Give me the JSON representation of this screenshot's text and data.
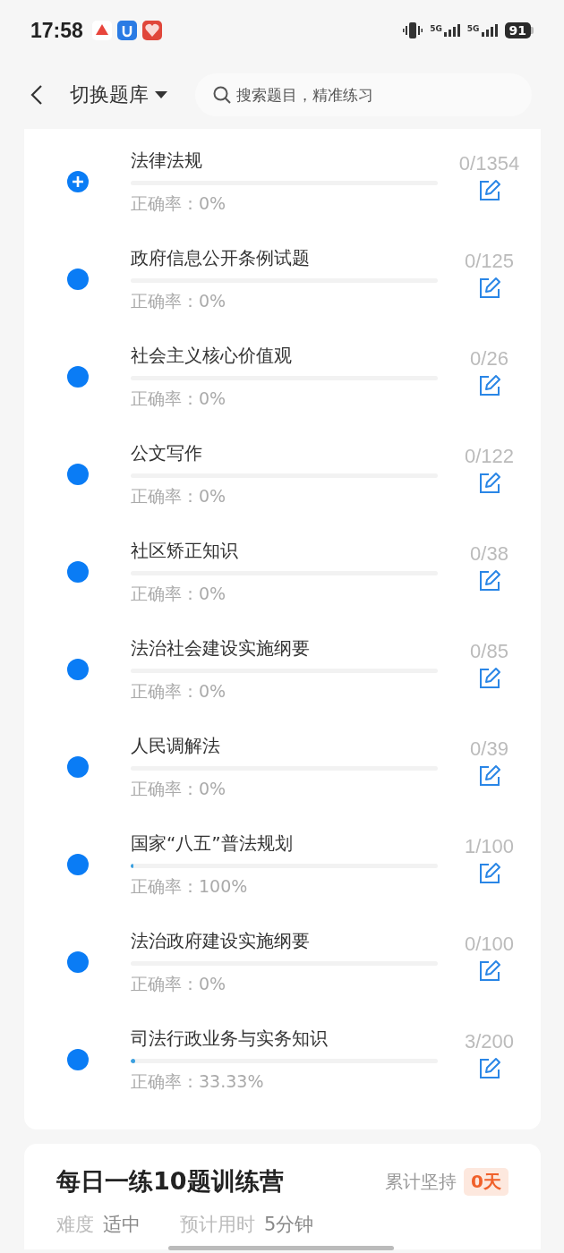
{
  "status_bar": {
    "time": "17:58",
    "network_1": "5G",
    "network_2": "5G",
    "battery": "91"
  },
  "nav": {
    "title": "切换题库",
    "search": {
      "placeholder": "搜索题目，精准练习"
    }
  },
  "categories": [
    {
      "name": "法律法规",
      "expandable": true,
      "level": 0,
      "accuracy": "正确率：0%",
      "count": "0/1354"
    },
    {
      "name": "政府信息公开条例试题",
      "expandable": false,
      "level": 0,
      "accuracy": "正确率：0%",
      "count": "0/125"
    },
    {
      "name": "社会主义核心价值观",
      "expandable": false,
      "level": 0,
      "accuracy": "正确率：0%",
      "count": "0/26"
    },
    {
      "name": "公文写作",
      "expandable": false,
      "level": 0,
      "accuracy": "正确率：0%",
      "count": "0/122"
    },
    {
      "name": "社区矫正知识",
      "expandable": false,
      "level": 0,
      "accuracy": "正确率：0%",
      "count": "0/38"
    },
    {
      "name": "法治社会建设实施纲要",
      "expandable": false,
      "level": 0,
      "accuracy": "正确率：0%",
      "count": "0/85"
    },
    {
      "name": "人民调解法",
      "expandable": false,
      "level": 0,
      "accuracy": "正确率：0%",
      "count": "0/39"
    },
    {
      "name": "国家“八五”普法规划",
      "expandable": false,
      "level": 0.01,
      "accuracy": "正确率：100%",
      "count": "1/100"
    },
    {
      "name": "法治政府建设实施纲要",
      "expandable": false,
      "level": 0,
      "accuracy": "正确率：0%",
      "count": "0/100"
    },
    {
      "name": "司法行政业务与实务知识",
      "expandable": false,
      "level": 0.015,
      "accuracy": "正确率：33.33%",
      "count": "3/200"
    }
  ],
  "camp": {
    "title": "每日一练10题训练营",
    "streak_label": "累计坚持",
    "streak_value": "0天",
    "difficulty_label": "难度",
    "difficulty_value": "适中",
    "time_label": "预计用时",
    "time_value": "5分钟"
  }
}
